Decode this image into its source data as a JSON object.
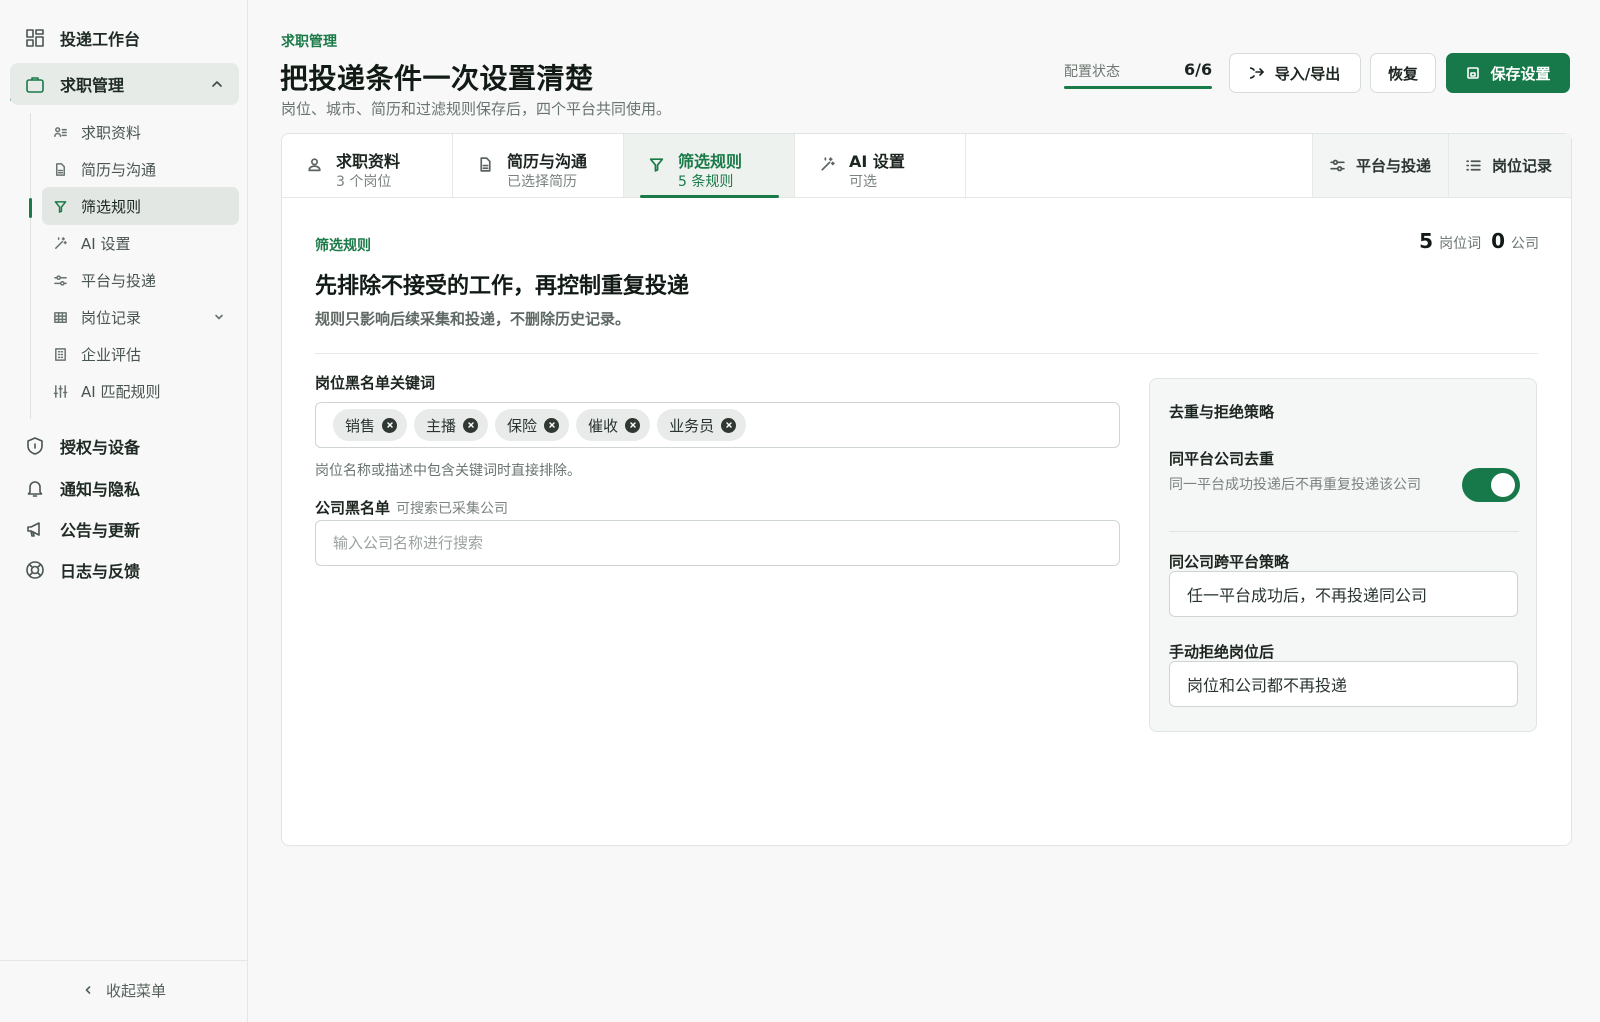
{
  "sidebar": {
    "top_items": [
      {
        "label": "投递工作台",
        "icon": "grid-icon"
      },
      {
        "label": "求职管理",
        "icon": "briefcase-icon"
      }
    ],
    "sub_items": [
      {
        "label": "求职资料",
        "icon": "profile-list-icon"
      },
      {
        "label": "简历与沟通",
        "icon": "document-icon"
      },
      {
        "label": "筛选规则",
        "icon": "filter-icon"
      },
      {
        "label": "AI 设置",
        "icon": "magic-wand-icon"
      },
      {
        "label": "平台与投递",
        "icon": "sliders-icon"
      },
      {
        "label": "岗位记录",
        "icon": "table-icon"
      },
      {
        "label": "企业评估",
        "icon": "building-icon"
      },
      {
        "label": "AI 匹配规则",
        "icon": "equalizer-icon"
      }
    ],
    "bottom_items": [
      {
        "label": "授权与设备",
        "icon": "shield-icon"
      },
      {
        "label": "通知与隐私",
        "icon": "bell-icon"
      },
      {
        "label": "公告与更新",
        "icon": "megaphone-icon"
      },
      {
        "label": "日志与反馈",
        "icon": "lifebuoy-icon"
      }
    ],
    "collapse_label": "收起菜单"
  },
  "header": {
    "eyebrow": "求职管理",
    "title": "把投递条件一次设置清楚",
    "subtitle": "岗位、城市、简历和过滤规则保存后，四个平台共同使用。",
    "status_label": "配置状态",
    "status_value": "6/6",
    "status_progress": 1.0,
    "import_export": "导入/导出",
    "restore": "恢复",
    "save": "保存设置"
  },
  "tabs": [
    {
      "title": "求职资料",
      "sub": "3 个岗位",
      "icon": "user-icon"
    },
    {
      "title": "简历与沟通",
      "sub": "已选择简历",
      "icon": "document-icon"
    },
    {
      "title": "筛选规则",
      "sub": "5 条规则",
      "icon": "filter-icon"
    },
    {
      "title": "AI 设置",
      "sub": "可选",
      "icon": "magic-wand-icon"
    }
  ],
  "right_tabs": [
    {
      "label": "平台与投递",
      "icon": "sliders-icon"
    },
    {
      "label": "岗位记录",
      "icon": "list-icon"
    }
  ],
  "section": {
    "eyebrow": "筛选规则",
    "title": "先排除不接受的工作，再控制重复投递",
    "subtitle": "规则只影响后续采集和投递，不删除历史记录。",
    "count_keywords": "5",
    "count_keywords_label": "岗位词",
    "count_companies": "0",
    "count_companies_label": "公司"
  },
  "blacklist": {
    "label": "岗位黑名单关键词",
    "tags": [
      "销售",
      "主播",
      "保险",
      "催收",
      "业务员"
    ],
    "help": "岗位名称或描述中包含关键词时直接排除。"
  },
  "company_blacklist": {
    "label": "公司黑名单",
    "hint": "可搜索已采集公司",
    "placeholder": "输入公司名称进行搜索"
  },
  "dedupe": {
    "title": "去重与拒绝策略",
    "same_platform_label": "同平台公司去重",
    "same_platform_desc": "同一平台成功投递后不再重复投递该公司",
    "same_platform_on": true,
    "cross_platform_label": "同公司跨平台策略",
    "cross_platform_value": "任一平台成功后，不再投递同公司",
    "reject_label": "手动拒绝岗位后",
    "reject_value": "岗位和公司都不再投递"
  },
  "colors": {
    "accent": "#17794a",
    "background": "#f7f8f7"
  }
}
